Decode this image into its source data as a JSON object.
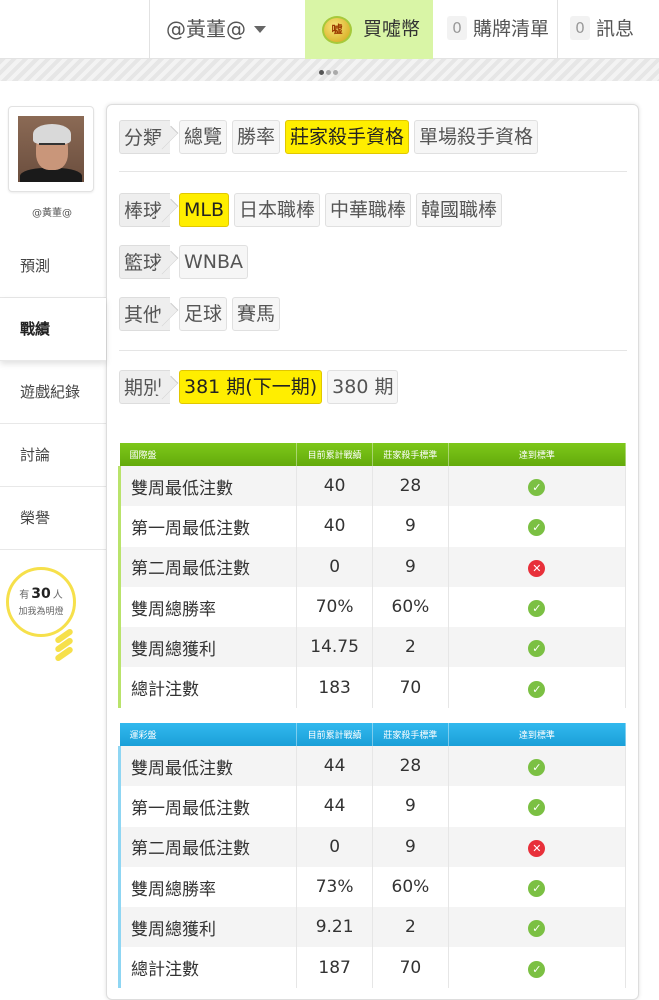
{
  "topbar": {
    "user": "@黃董@",
    "coin_icon_text": "嘘",
    "coin_label": "買噓幣",
    "cart_count": "0",
    "cart_label": "購牌清單",
    "msg_count": "0",
    "msg_label": "訊息"
  },
  "sidebar": {
    "username": "@黃董@",
    "items": [
      {
        "label": "預測",
        "active": false
      },
      {
        "label": "戰績",
        "active": true
      },
      {
        "label": "遊戲紀錄",
        "active": false
      },
      {
        "label": "討論",
        "active": false
      },
      {
        "label": "榮譽",
        "active": false
      }
    ],
    "bulb": {
      "prefix": "有",
      "count": "30",
      "suffix": "人",
      "line2": "加我為明燈"
    }
  },
  "filters": {
    "category": {
      "label": "分類",
      "options": [
        "總覽",
        "勝率",
        "莊家殺手資格",
        "單場殺手資格"
      ],
      "selected": "莊家殺手資格"
    },
    "baseball": {
      "label": "棒球",
      "options": [
        "MLB",
        "日本職棒",
        "中華職棒",
        "韓國職棒"
      ],
      "selected": "MLB"
    },
    "basketball": {
      "label": "籃球",
      "options": [
        "WNBA"
      ],
      "selected": ""
    },
    "other": {
      "label": "其他",
      "options": [
        "足球",
        "賽馬"
      ],
      "selected": ""
    },
    "period": {
      "label": "期別",
      "options": [
        "381 期(下一期)",
        "380 期"
      ],
      "selected": "381 期(下一期)"
    }
  },
  "tables": [
    {
      "header": [
        "國際盤",
        "目前累計戰績",
        "莊家殺手標準",
        "達到標準"
      ],
      "rows": [
        {
          "name": "雙周最低注數",
          "current": "40",
          "standard": "28",
          "met": true
        },
        {
          "name": "第一周最低注數",
          "current": "40",
          "standard": "9",
          "met": true
        },
        {
          "name": "第二周最低注數",
          "current": "0",
          "standard": "9",
          "met": false
        },
        {
          "name": "雙周總勝率",
          "current": "70%",
          "standard": "60%",
          "met": true
        },
        {
          "name": "雙周總獲利",
          "current": "14.75",
          "standard": "2",
          "met": true
        },
        {
          "name": "總計注數",
          "current": "183",
          "standard": "70",
          "met": true
        }
      ]
    },
    {
      "header": [
        "運彩盤",
        "目前累計戰績",
        "莊家殺手標準",
        "達到標準"
      ],
      "rows": [
        {
          "name": "雙周最低注數",
          "current": "44",
          "standard": "28",
          "met": true
        },
        {
          "name": "第一周最低注數",
          "current": "44",
          "standard": "9",
          "met": true
        },
        {
          "name": "第二周最低注數",
          "current": "0",
          "standard": "9",
          "met": false
        },
        {
          "name": "雙周總勝率",
          "current": "73%",
          "standard": "60%",
          "met": true
        },
        {
          "name": "雙周總獲利",
          "current": "9.21",
          "standard": "2",
          "met": true
        },
        {
          "name": "總計注數",
          "current": "187",
          "standard": "70",
          "met": true
        }
      ]
    }
  ],
  "colors": {
    "accent_yellow": "#ffee00",
    "intl_header": "#6fb812",
    "lottery_header": "#22aae2",
    "ok": "#7bc043",
    "fail": "#e8303a"
  }
}
